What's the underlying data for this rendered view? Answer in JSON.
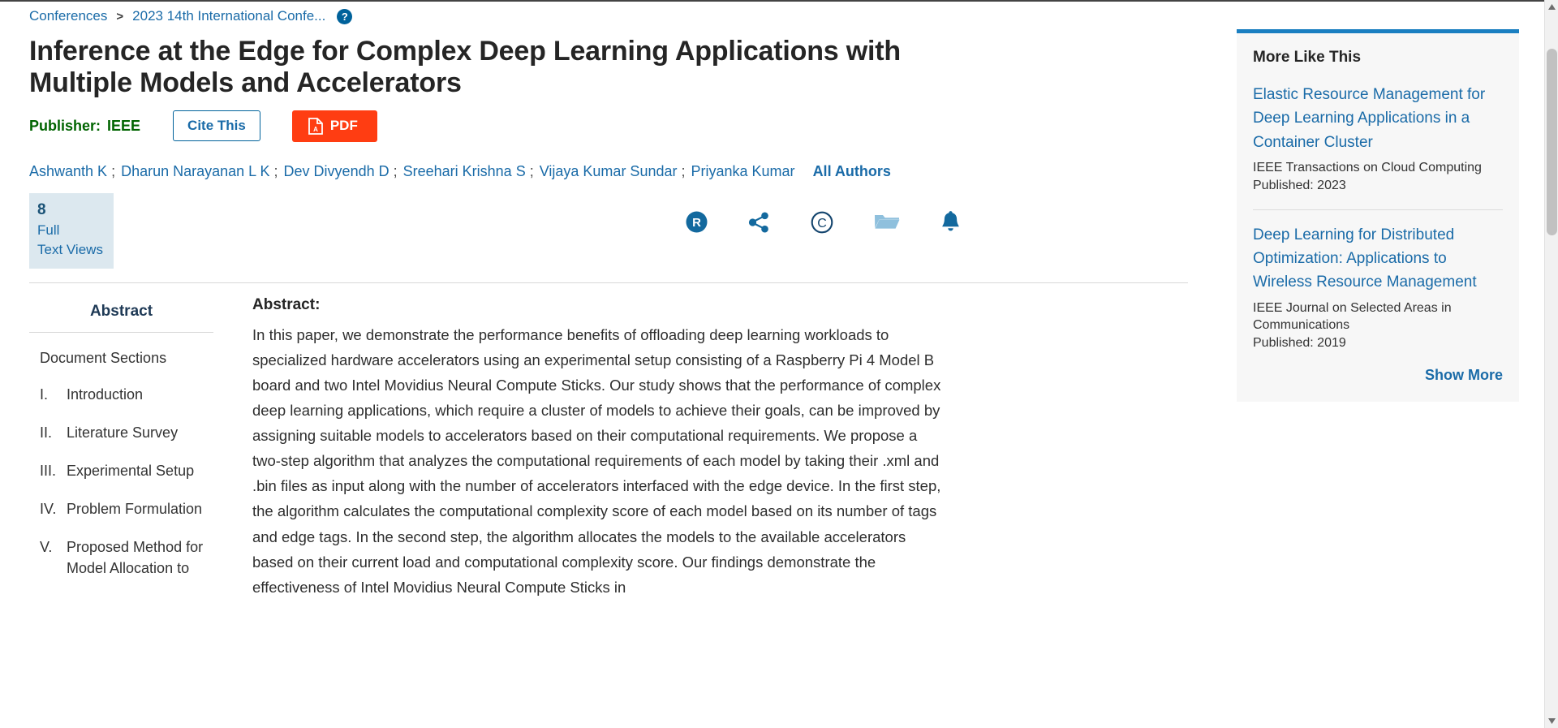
{
  "breadcrumb": {
    "root": "Conferences",
    "separator": ">",
    "current": "2023 14th International Confe...",
    "help_icon": "help-circle-icon"
  },
  "document": {
    "title": "Inference at the Edge for Complex Deep Learning Applications with Multiple Models and Accelerators",
    "publisher_label": "Publisher:",
    "publisher_name": "IEEE",
    "cite_button": "Cite This",
    "pdf_button": "PDF"
  },
  "authors": {
    "list": [
      "Ashwanth K",
      "Dharun Narayanan L K",
      "Dev Divyendh D",
      "Sreehari Krishna S",
      "Vijaya Kumar Sundar",
      "Priyanka Kumar"
    ],
    "separator": ";",
    "all_authors_link": "All Authors"
  },
  "metrics": {
    "count": "8",
    "label_line1": "Full",
    "label_line2": "Text Views"
  },
  "action_icons": [
    {
      "name": "research-alerts-icon",
      "label": "R"
    },
    {
      "name": "share-icon",
      "label": "Share"
    },
    {
      "name": "copyright-icon",
      "label": "Copyright"
    },
    {
      "name": "folder-icon",
      "label": "Save to Project"
    },
    {
      "name": "bell-alerts-icon",
      "label": "Alerts"
    }
  ],
  "sections_panel": {
    "abstract_tab": "Abstract",
    "heading": "Document Sections",
    "items": [
      {
        "num": "I.",
        "label": "Introduction"
      },
      {
        "num": "II.",
        "label": "Literature Survey"
      },
      {
        "num": "III.",
        "label": "Experimental Setup"
      },
      {
        "num": "IV.",
        "label": "Problem Formulation"
      },
      {
        "num": "V.",
        "label": "Proposed Method for Model Allocation to"
      }
    ]
  },
  "abstract": {
    "heading": "Abstract:",
    "text": "In this paper, we demonstrate the performance benefits of offloading deep learning workloads to specialized hardware accelerators using an experimental setup consisting of a Raspberry Pi 4 Model B board and two Intel Movidius Neural Compute Sticks. Our study shows that the performance of complex deep learning applications, which require a cluster of models to achieve their goals, can be improved by assigning suitable models to accelerators based on their computational requirements. We propose a two-step algorithm that analyzes the computational requirements of each model by taking their .xml and .bin files as input along with the number of accelerators interfaced with the edge device. In the first step, the algorithm calculates the computational complexity score of each model based on its number of tags and edge tags. In the second step, the algorithm allocates the models to the available accelerators based on their current load and computational complexity score. Our findings demonstrate the effectiveness of Intel Movidius Neural Compute Sticks in"
  },
  "more_like_this": {
    "heading": "More Like This",
    "items": [
      {
        "title": "Elastic Resource Management for Deep Learning Applications in a Container Cluster",
        "publication": "IEEE Transactions on Cloud Computing",
        "published": "Published: 2023"
      },
      {
        "title": "Deep Learning for Distributed Optimization: Applications to Wireless Resource Management",
        "publication": "IEEE Journal on Selected Areas in Communications",
        "published": "Published: 2019"
      }
    ],
    "show_more": "Show More"
  },
  "colors": {
    "link_blue": "#1a6ba8",
    "publisher_green": "#006400",
    "pdf_red": "#ff3d12",
    "accent_blue": "#00629b",
    "metric_bg": "#dce8ef",
    "rail_bg": "#f7f7f7"
  }
}
